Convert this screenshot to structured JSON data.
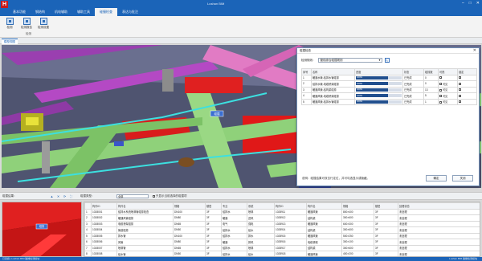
{
  "app": {
    "logo_text": "H",
    "title": "Lushan BIM",
    "window_controls": [
      "–",
      "□",
      "✕"
    ]
  },
  "ribbon": {
    "tabs": [
      "基本功能",
      "钢结构",
      "机电辅助",
      "辅助工具",
      "碰撞检查",
      "表达与批注"
    ],
    "active_tab": 4,
    "buttons": [
      "检测",
      "检测报告",
      "检测设置"
    ],
    "group_label": "检测"
  },
  "doc_tab": "模型视图",
  "dialog": {
    "title": "碰撞检查",
    "close": "✕",
    "rule_label": "检测规则：",
    "rule_value": "管线综合碰撞规则",
    "edit_icon": "✎",
    "columns": [
      "序号",
      "名称",
      "进度",
      "状态",
      "碰撞数",
      "可视",
      "锁定"
    ],
    "rows": [
      {
        "index": "1",
        "name": "暖通水管-给排水管碰撞",
        "progress_text": "100%",
        "progress": 1.0,
        "status": "已完成",
        "count": "0",
        "visible": "",
        "locked": ""
      },
      {
        "index": "2",
        "name": "给排水管-电缆桥架碰撞",
        "progress_text": "100%",
        "progress": 1.0,
        "status": "已完成",
        "count": "0",
        "visible": "可见",
        "locked": ""
      },
      {
        "index": "3",
        "name": "暖通风管-结构梁碰撞",
        "progress_text": "100%",
        "progress": 1.0,
        "status": "已完成",
        "count": "13",
        "visible": "可见",
        "locked": ""
      },
      {
        "index": "4",
        "name": "暖通风管-电缆桥架碰撞",
        "progress_text": "100%",
        "progress": 1.0,
        "status": "已完成",
        "count": "5",
        "visible": "可见",
        "locked": ""
      },
      {
        "index": "5",
        "name": "暖通风管-给排水管碰撞",
        "progress_text": "100%",
        "progress": 1.0,
        "status": "已完成",
        "count": "1",
        "visible": "可见",
        "locked": ""
      }
    ],
    "hint": "说明：碰撞结果可双击行定位，并可勾选显示或隐藏。",
    "ok": "确定",
    "cancel": "关闭"
  },
  "bottom_bar": {
    "label_left": "碰撞结果：",
    "label_filter": "碰撞类型：",
    "filter_value": "全部",
    "checkbox_label": "只显示当前选择的碰撞项",
    "icons": [
      "▲",
      "✕",
      "⟳",
      "⛶"
    ]
  },
  "bottom_table": {
    "columns": [
      "",
      "构件ID",
      "构件名",
      "规格",
      "楼层",
      "专业",
      "系统",
      "构件ID",
      "构件名",
      "规格",
      "楼层",
      "处理状态"
    ],
    "rows": [
      [
        "1",
        "1028001",
        "给排水系统喷淋管碰撞检查",
        "DN100",
        "3F",
        "给排水",
        "喷淋",
        "1028911",
        "暖通风管",
        "800×400",
        "3F",
        "未处理"
      ],
      [
        "2",
        "1028002",
        "暖通风管碰撞",
        "DN80",
        "3F",
        "暖通",
        "送风",
        "1028912",
        "结构梁",
        "300×600",
        "3F",
        "未处理"
      ],
      [
        "3",
        "1028003",
        "电缆桥架碰撞",
        "DN65",
        "3F",
        "电气",
        "强电",
        "1028913",
        "暖通风管",
        "600×300",
        "3F",
        "未处理"
      ],
      [
        "4",
        "1028004",
        "管道碰撞",
        "DN50",
        "3F",
        "给排水",
        "给水",
        "1028914",
        "结构梁",
        "300×600",
        "3F",
        "未处理"
      ],
      [
        "5",
        "1028005",
        "排水管",
        "DN100",
        "3F",
        "给排水",
        "排水",
        "1028915",
        "暖通风管",
        "500×250",
        "3F",
        "未处理"
      ],
      [
        "6",
        "1028006",
        "风管",
        "DN80",
        "3F",
        "暖通",
        "排风",
        "1028916",
        "电缆桥架",
        "300×100",
        "3F",
        "未处理"
      ],
      [
        "7",
        "1028007",
        "喷淋管",
        "DN65",
        "3F",
        "给排水",
        "喷淋",
        "1028917",
        "结构梁",
        "300×600",
        "3F",
        "未处理"
      ],
      [
        "8",
        "1028008",
        "给水管",
        "DN50",
        "3F",
        "给排水",
        "给水",
        "1028918",
        "暖通风管",
        "400×200",
        "3F",
        "未处理"
      ]
    ]
  },
  "viewport": {
    "tag_main": "碰撞",
    "tag_mini": "碰撞"
  },
  "status": {
    "left": "已就绪 | Lushan BIM 碰撞检测模块",
    "right": "Lushan BIM 碰撞检测模块"
  }
}
